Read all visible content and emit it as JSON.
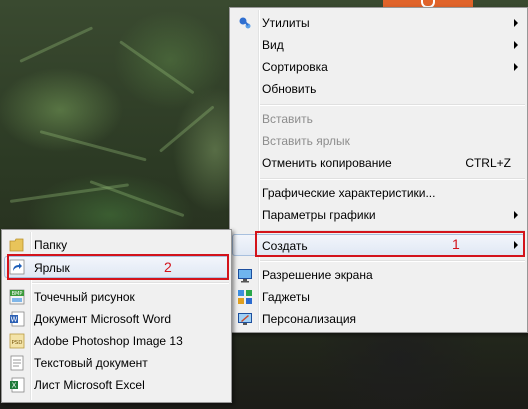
{
  "main_menu": {
    "items": [
      {
        "label": "Утилиты",
        "icon": "utilities-icon",
        "submenu": true
      },
      {
        "label": "Вид",
        "submenu": true
      },
      {
        "label": "Сортировка",
        "submenu": true
      },
      {
        "label": "Обновить"
      },
      {
        "label": "Вставить",
        "disabled": true
      },
      {
        "label": "Вставить ярлык",
        "disabled": true
      },
      {
        "label": "Отменить копирование",
        "shortcut": "CTRL+Z"
      },
      {
        "label": "Графические характеристики..."
      },
      {
        "label": "Параметры графики",
        "submenu": true
      },
      {
        "label": "Создать",
        "submenu": true,
        "highlighted": true
      },
      {
        "label": "Разрешение экрана",
        "icon": "display-resolution-icon"
      },
      {
        "label": "Гаджеты",
        "icon": "gadgets-icon"
      },
      {
        "label": "Персонализация",
        "icon": "personalization-icon"
      }
    ]
  },
  "sub_menu": {
    "items": [
      {
        "label": "Папку",
        "icon": "folder-icon"
      },
      {
        "label": "Ярлык",
        "icon": "shortcut-icon",
        "highlighted": true
      },
      {
        "label": "Точечный рисунок",
        "icon": "bitmap-icon"
      },
      {
        "label": "Документ Microsoft Word",
        "icon": "word-document-icon"
      },
      {
        "label": "Adobe Photoshop Image 13",
        "icon": "photoshop-image-icon"
      },
      {
        "label": "Текстовый документ",
        "icon": "text-document-icon"
      },
      {
        "label": "Лист Microsoft Excel",
        "icon": "excel-sheet-icon"
      }
    ]
  },
  "annotations": {
    "create_number": "1",
    "shortcut_number": "2"
  },
  "icon_text": {
    "bmp": "BMP",
    "psd": "PSD",
    "word": "W",
    "excel": "X"
  },
  "colors": {
    "annotation": "#d3131b",
    "menu_bg": "#f0f0f0",
    "hover_border": "#a8c0de"
  }
}
